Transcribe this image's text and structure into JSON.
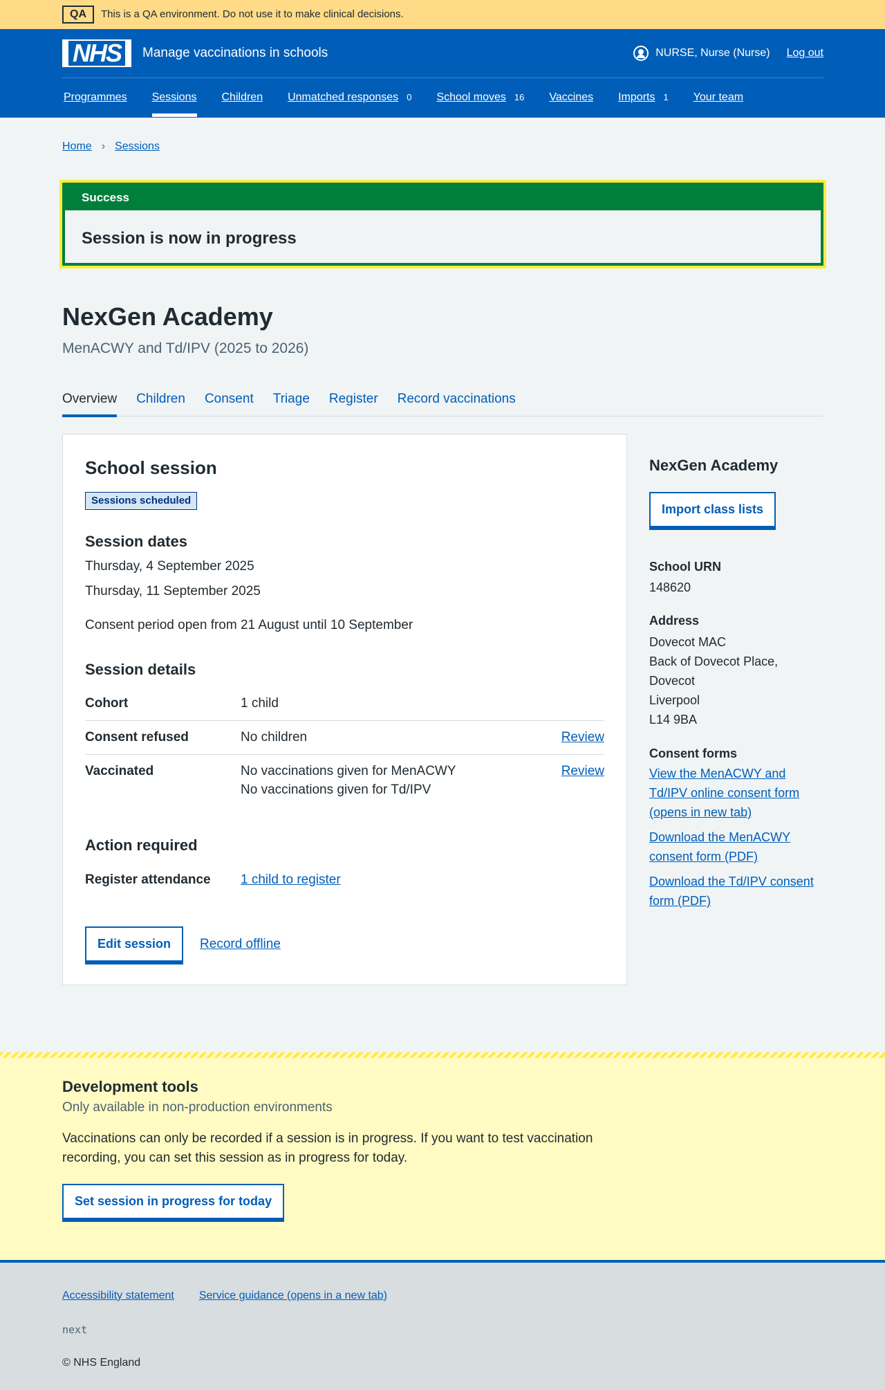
{
  "qa": {
    "tag": "QA",
    "text": "This is a QA environment. Do not use it to make clinical decisions."
  },
  "header": {
    "logo": "NHS",
    "service_name": "Manage vaccinations in schools",
    "user": "NURSE, Nurse (Nurse)",
    "logout": "Log out"
  },
  "nav": [
    {
      "label": "Programmes",
      "count": ""
    },
    {
      "label": "Sessions",
      "count": ""
    },
    {
      "label": "Children",
      "count": ""
    },
    {
      "label": "Unmatched responses",
      "count": "0"
    },
    {
      "label": "School moves",
      "count": "16"
    },
    {
      "label": "Vaccines",
      "count": ""
    },
    {
      "label": "Imports",
      "count": "1"
    },
    {
      "label": "Your team",
      "count": ""
    }
  ],
  "breadcrumb": {
    "home": "Home",
    "sessions": "Sessions",
    "separator": "›"
  },
  "notice": {
    "title": "Success",
    "body": "Session is now in progress"
  },
  "page": {
    "title": "NexGen Academy",
    "caption": "MenACWY and Td/IPV (2025 to 2026)"
  },
  "tabs": [
    "Overview",
    "Children",
    "Consent",
    "Triage",
    "Register",
    "Record vaccinations"
  ],
  "card": {
    "title": "School session",
    "status": "Sessions scheduled",
    "dates_heading": "Session dates",
    "dates": [
      "Thursday, 4 September 2025",
      "Thursday, 11 September 2025"
    ],
    "consent_period": "Consent period open from 21 August until 10 September",
    "details_heading": "Session details",
    "details": {
      "cohort_key": "Cohort",
      "cohort_value": "1 child",
      "refused_key": "Consent refused",
      "refused_value": "No children",
      "refused_action": "Review",
      "vaccinated_key": "Vaccinated",
      "vaccinated_value_1": "No vaccinations given for MenACWY",
      "vaccinated_value_2": "No vaccinations given for Td/IPV",
      "vaccinated_action": "Review"
    },
    "action_heading": "Action required",
    "register_key": "Register attendance",
    "register_link": "1 child to register",
    "edit_button": "Edit session",
    "offline_link": "Record offline"
  },
  "aside": {
    "title": "NexGen Academy",
    "import_button": "Import class lists",
    "urn_heading": "School URN",
    "urn": "148620",
    "address_heading": "Address",
    "address": [
      "Dovecot MAC",
      "Back of Dovecot Place,",
      "Dovecot",
      "Liverpool",
      "L14 9BA"
    ],
    "consent_heading": "Consent forms",
    "consent_links": [
      "View the MenACWY and Td/IPV online consent form (opens in new tab)",
      "Download the MenACWY consent form (PDF)",
      "Download the Td/IPV consent form (PDF)"
    ]
  },
  "devtools": {
    "title": "Development tools",
    "subtitle": "Only available in non-production environments",
    "description": "Vaccinations can only be recorded if a session is in progress. If you want to test vaccination recording, you can set this session as in progress for today.",
    "button": "Set session in progress for today"
  },
  "footer": {
    "links": [
      "Accessibility statement",
      "Service guidance (opens in a new tab)"
    ],
    "commit": "next",
    "copyright": "© NHS England"
  },
  "colors": {
    "nhs_blue": "#005eb8",
    "success_green": "#007f3b",
    "qa_yellow": "#ffdb87",
    "dev_yellow": "#fffbc2"
  }
}
